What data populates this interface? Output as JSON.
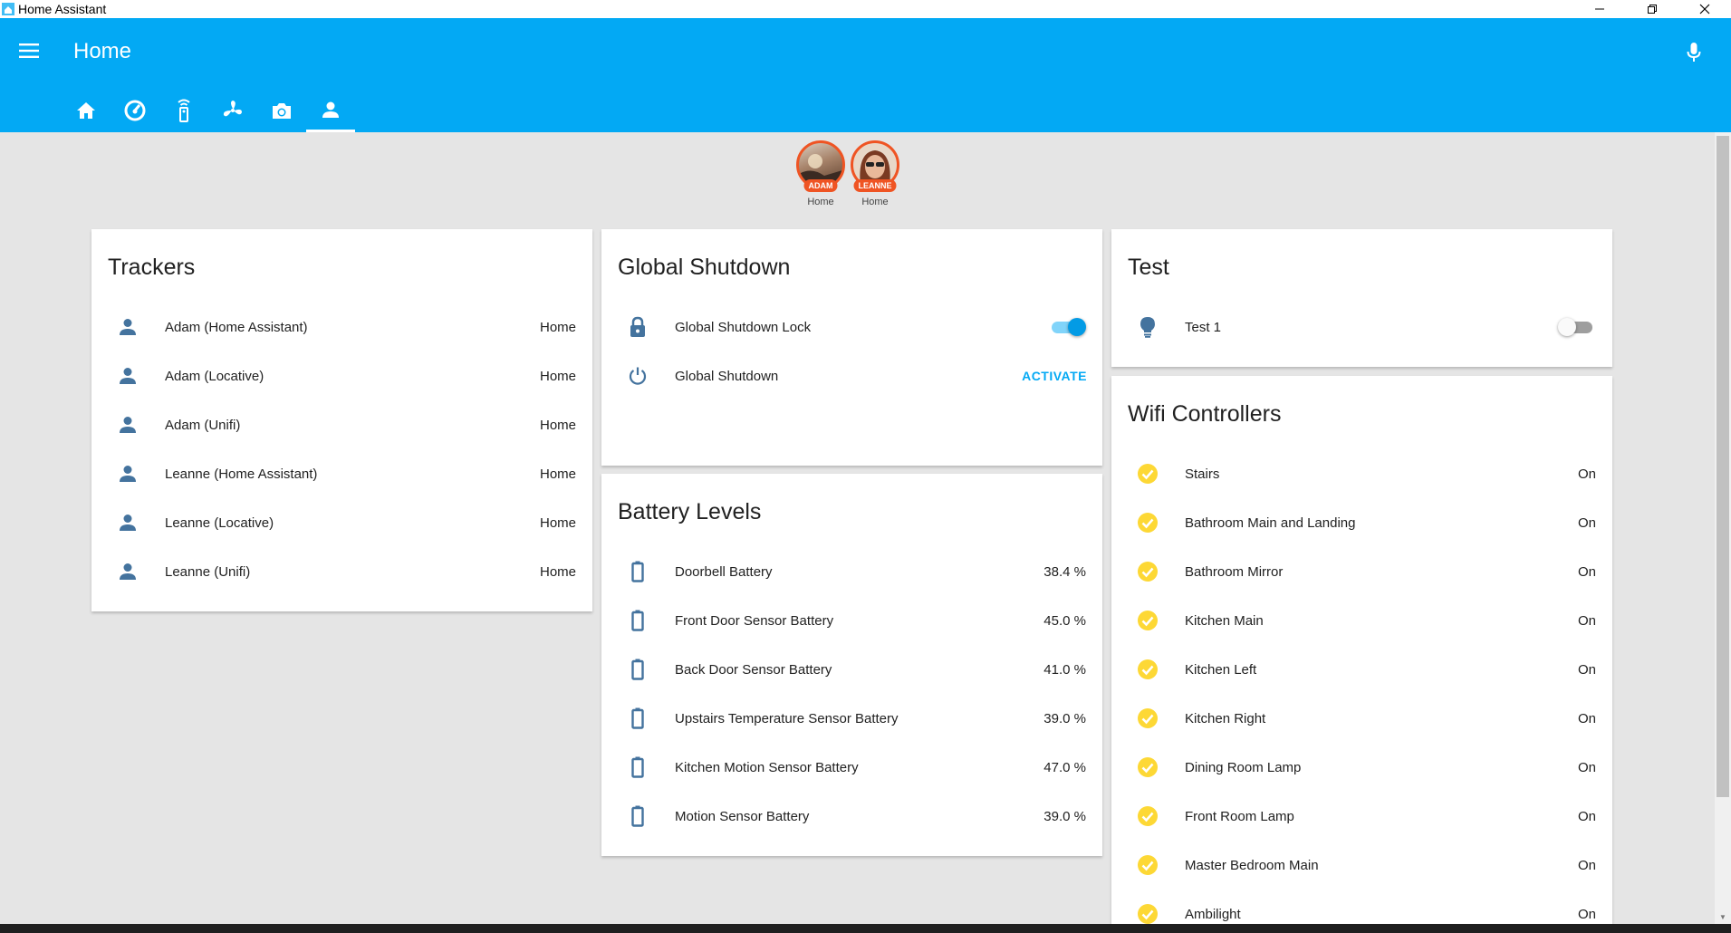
{
  "window": {
    "title": "Home Assistant"
  },
  "header": {
    "title": "Home"
  },
  "colors": {
    "primary": "#03a9f4",
    "badge": "#ef5423",
    "icon": "#44739e",
    "check": "#fdd835"
  },
  "tabs": [
    {
      "icon": "home-icon"
    },
    {
      "icon": "speedometer-icon"
    },
    {
      "icon": "remote-icon"
    },
    {
      "icon": "fan-icon"
    },
    {
      "icon": "camera-icon"
    },
    {
      "icon": "person-icon",
      "active": true
    }
  ],
  "badges": [
    {
      "label": "ADAM",
      "state": "Home"
    },
    {
      "label": "LEANNE",
      "state": "Home"
    }
  ],
  "trackers": {
    "title": "Trackers",
    "rows": [
      {
        "name": "Adam (Home Assistant)",
        "state": "Home"
      },
      {
        "name": "Adam (Locative)",
        "state": "Home"
      },
      {
        "name": "Adam (Unifi)",
        "state": "Home"
      },
      {
        "name": "Leanne (Home Assistant)",
        "state": "Home"
      },
      {
        "name": "Leanne (Locative)",
        "state": "Home"
      },
      {
        "name": "Leanne (Unifi)",
        "state": "Home"
      }
    ]
  },
  "global_shutdown": {
    "title": "Global Shutdown",
    "lock_name": "Global Shutdown Lock",
    "lock_on": true,
    "script_name": "Global Shutdown",
    "action_label": "ACTIVATE"
  },
  "battery": {
    "title": "Battery Levels",
    "rows": [
      {
        "name": "Doorbell Battery",
        "state": "38.4 %"
      },
      {
        "name": "Front Door Sensor Battery",
        "state": "45.0 %"
      },
      {
        "name": "Back Door Sensor Battery",
        "state": "41.0 %"
      },
      {
        "name": "Upstairs Temperature Sensor Battery",
        "state": "39.0 %"
      },
      {
        "name": "Kitchen Motion Sensor Battery",
        "state": "47.0 %"
      },
      {
        "name": "Motion Sensor Battery",
        "state": "39.0 %"
      }
    ]
  },
  "test": {
    "title": "Test",
    "row_name": "Test 1",
    "row_on": false
  },
  "wifi": {
    "title": "Wifi Controllers",
    "rows": [
      {
        "name": "Stairs",
        "state": "On"
      },
      {
        "name": "Bathroom Main and Landing",
        "state": "On"
      },
      {
        "name": "Bathroom Mirror",
        "state": "On"
      },
      {
        "name": "Kitchen Main",
        "state": "On"
      },
      {
        "name": "Kitchen Left",
        "state": "On"
      },
      {
        "name": "Kitchen Right",
        "state": "On"
      },
      {
        "name": "Dining Room Lamp",
        "state": "On"
      },
      {
        "name": "Front Room Lamp",
        "state": "On"
      },
      {
        "name": "Master Bedroom Main",
        "state": "On"
      },
      {
        "name": "Ambilight",
        "state": "On"
      }
    ]
  }
}
